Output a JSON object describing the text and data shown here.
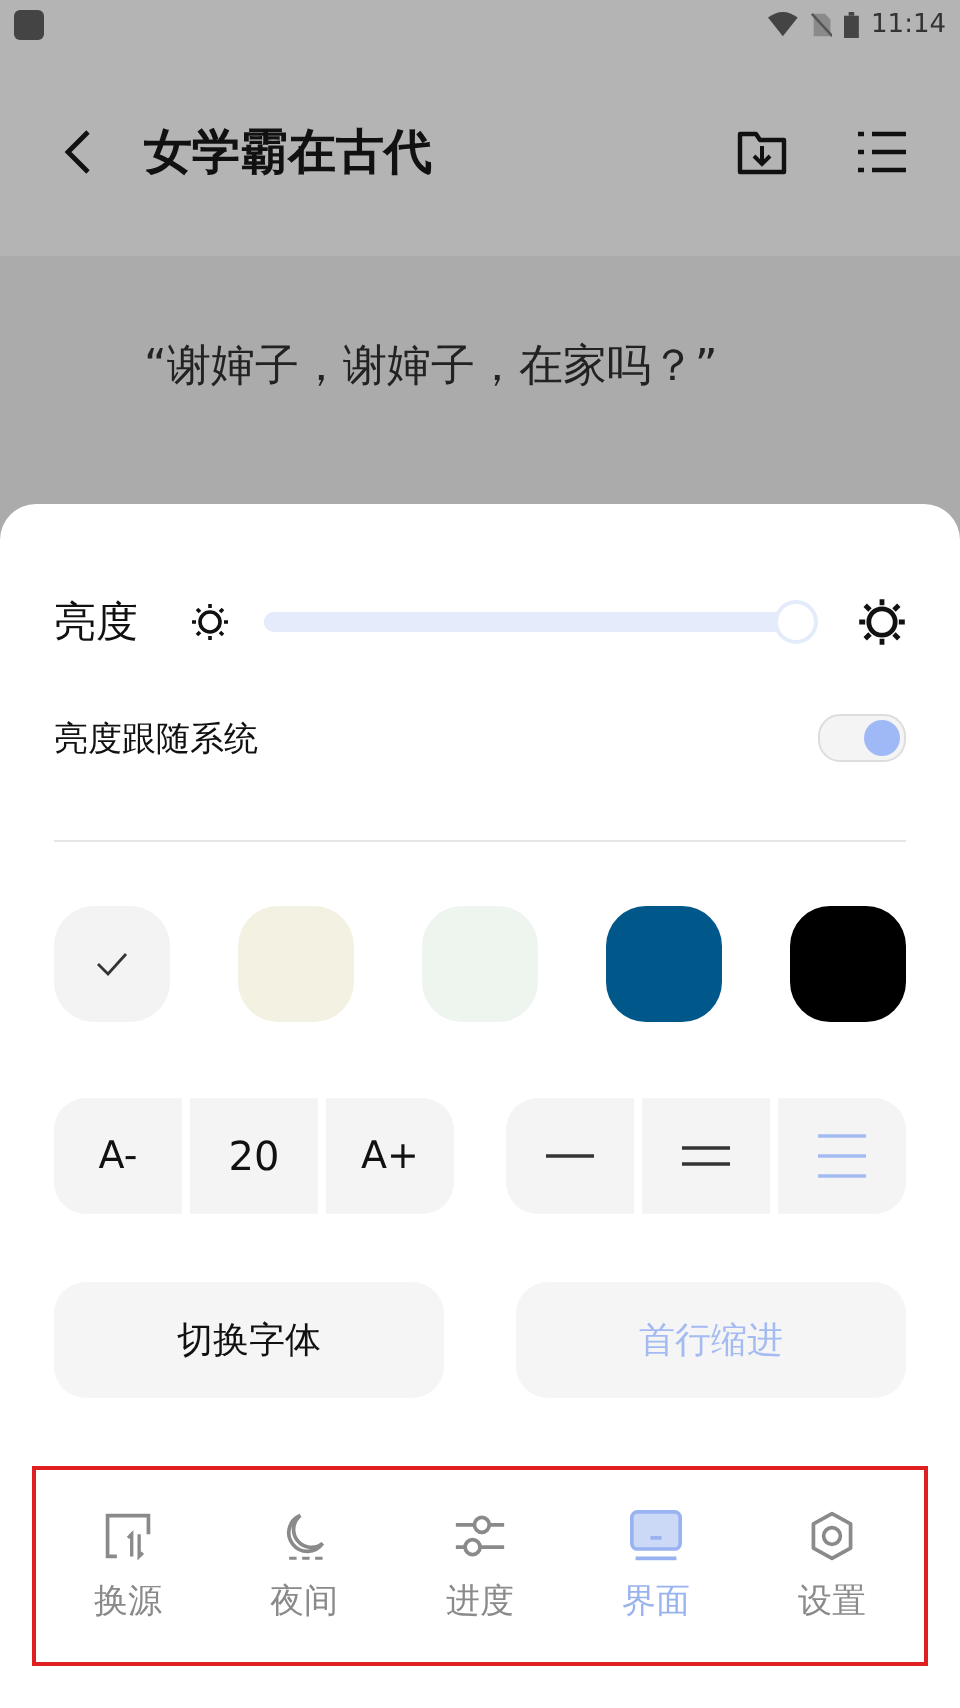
{
  "status_bar": {
    "time": "11:14"
  },
  "app_bar": {
    "title": "女学霸在古代"
  },
  "reader": {
    "paragraphs": [
      "“谢婶子，谢婶子，在家吗？”"
    ]
  },
  "settings_sheet": {
    "brightness": {
      "label": "亮度",
      "level": 0.97
    },
    "follow_system": {
      "label": "亮度跟随系统",
      "on": true
    },
    "themes": [
      {
        "color": "#f3f3f3",
        "selected": true
      },
      {
        "color": "#f3f1e2",
        "selected": false
      },
      {
        "color": "#eef5ef",
        "selected": false
      },
      {
        "color": "#00578a",
        "selected": false
      },
      {
        "color": "#000000",
        "selected": false
      }
    ],
    "font_size": {
      "decrease": "A-",
      "value": "20",
      "increase": "A+"
    },
    "line_spacing": [
      {
        "selected": false
      },
      {
        "selected": false
      },
      {
        "selected": true
      }
    ],
    "buttons": [
      {
        "label": "切换字体",
        "on": false
      },
      {
        "label": "首行缩进",
        "on": true
      }
    ]
  },
  "bottom_nav": [
    {
      "label": "换源",
      "kind": "swap",
      "selected": false
    },
    {
      "label": "夜间",
      "kind": "moon",
      "selected": false
    },
    {
      "label": "进度",
      "kind": "sliders",
      "selected": false
    },
    {
      "label": "界面",
      "kind": "screen",
      "selected": true
    },
    {
      "label": "设置",
      "kind": "gear",
      "selected": false
    }
  ]
}
